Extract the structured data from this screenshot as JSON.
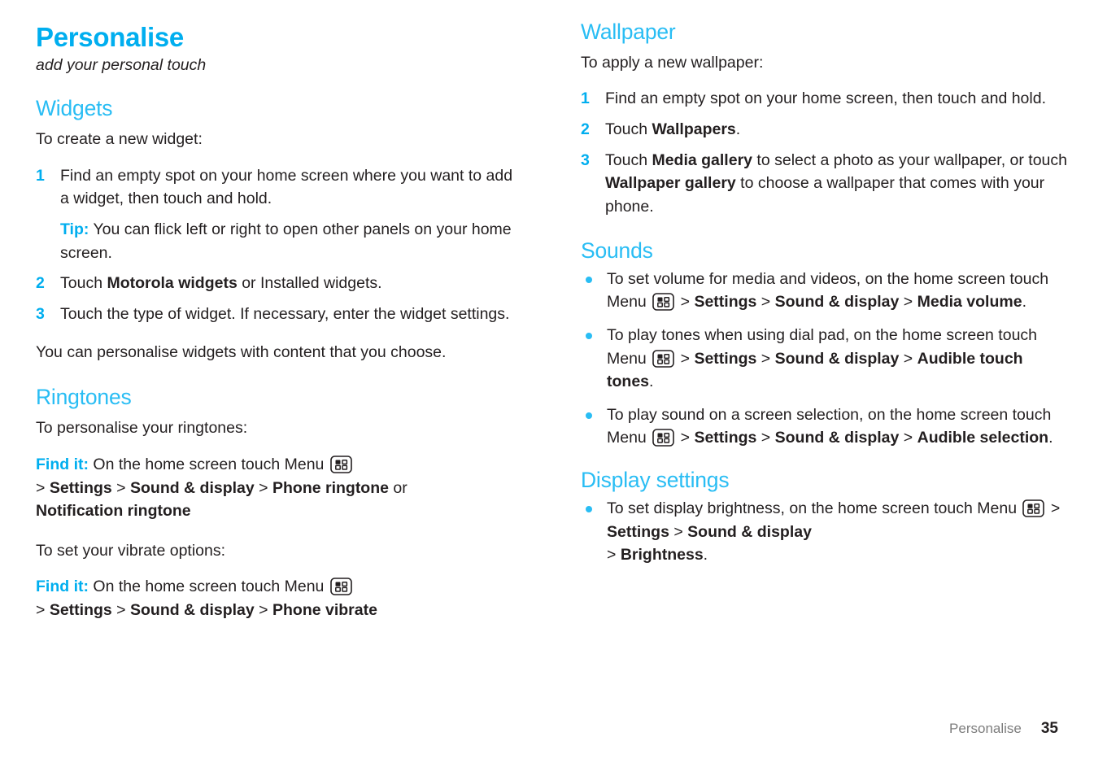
{
  "chapter": {
    "title": "Personalise",
    "subtitle": "add your personal touch"
  },
  "icons": {
    "menu_key": "menu-key-icon"
  },
  "colors": {
    "accent": "#00AEEF",
    "heading": "#29BDF4",
    "text": "#231f20",
    "footer_text": "#7d7d7d"
  },
  "left_column": {
    "widgets": {
      "heading": "Widgets",
      "intro": "To create a new widget:",
      "steps": [
        {
          "num": "1",
          "text": "Find an empty spot on your home screen where you want to add a widget, then touch and hold."
        },
        {
          "num": "2",
          "pre": "Touch ",
          "bold": "Motorola widgets",
          "post": " or Installed widgets."
        },
        {
          "num": "3",
          "text": "Touch the type of widget. If necessary, enter the widget settings."
        }
      ],
      "tip_label": "Tip:",
      "tip_text": " You can flick left or right to open other panels on your home screen.",
      "outro": "You can personalise widgets with content that you choose."
    },
    "ringtones": {
      "heading": "Ringtones",
      "intro": "To personalise your ringtones:",
      "findit_label": "Find it:",
      "findit_text": " On the home screen touch Menu ",
      "path_1a": "Settings",
      "path_1b": "Sound & display",
      "path_1c": "Phone ringtone",
      "path_1_or": " or",
      "path_1d": "Notification ringtone",
      "vibrate_intro": "To set your vibrate options:",
      "findit_label_2": "Find it:",
      "findit_text_2": " On the home screen touch Menu ",
      "path_2a": "Settings",
      "path_2b": "Sound & display",
      "path_2c": "Phone vibrate",
      "sep": ">"
    }
  },
  "right_column": {
    "wallpaper": {
      "heading": "Wallpaper",
      "intro": "To apply a new wallpaper:",
      "steps": [
        {
          "num": "1",
          "text": "Find an empty spot on your home screen, then touch and hold."
        },
        {
          "num": "2",
          "pre": "Touch ",
          "bold": "Wallpapers",
          "post": "."
        },
        {
          "num": "3",
          "pre": "Touch ",
          "bold": "Media gallery",
          "mid": " to select a photo as your wallpaper, or touch ",
          "bold2": "Wallpaper gallery",
          "post": " to choose a wallpaper that comes with your phone."
        }
      ]
    },
    "sounds": {
      "heading": "Sounds",
      "bullets": [
        {
          "lead": "To set volume for media and videos, on the home screen touch Menu ",
          "p1": "Settings",
          "p2": "Sound & display",
          "p3": "Media volume",
          "end": "."
        },
        {
          "lead": "To play tones when using dial pad, on the home screen touch Menu ",
          "p1": "Settings",
          "p2": "Sound & display",
          "p3": "Audible touch tones",
          "end": "."
        },
        {
          "lead": "To play sound on a screen selection, on the home screen touch Menu ",
          "p1": "Settings",
          "p2": "Sound & display",
          "p3": "Audible selection",
          "end": "."
        }
      ],
      "sep": ">"
    },
    "display_settings": {
      "heading": "Display settings",
      "bullets": [
        {
          "lead": "To set display brightness, on the home screen touch Menu ",
          "p1": "Settings",
          "p2": "Sound & display",
          "p3": "Brightness",
          "end": "."
        }
      ],
      "sep": ">"
    }
  },
  "footer": {
    "section": "Personalise",
    "page_number": "35"
  }
}
